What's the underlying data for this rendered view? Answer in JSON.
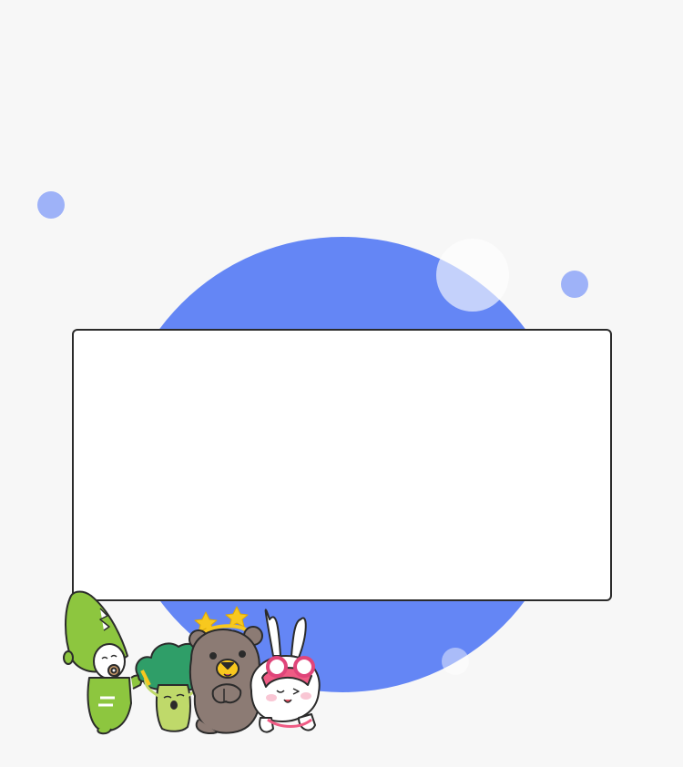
{
  "colors": {
    "background": "#f7f7f7",
    "accent": "#6486f5",
    "accent_light": "#8ea6f8",
    "card_background": "#ffffff",
    "card_border": "#2b2b2b"
  },
  "card": {
    "text": ""
  },
  "decoration": {
    "icons": [
      "crocodile-character-icon",
      "broccoli-character-icon",
      "bear-character-icon",
      "rabbit-character-icon"
    ]
  }
}
